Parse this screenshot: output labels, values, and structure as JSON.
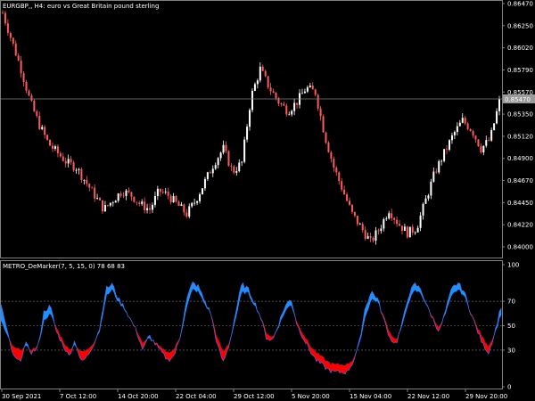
{
  "header": {
    "symbol_title": "EURGBP,, H4:  euro vs Great Britain pound sterling",
    "current_price": "0.85470"
  },
  "indicator": {
    "title": "METRO_DeMarker(7, 5, 15, 0) 78 68 83"
  },
  "colors": {
    "background": "#000000",
    "bull_candle": "#ffffff",
    "bear_candle": "#ff5a5a",
    "up_fill": "#1e90ff",
    "down_fill": "#ff0000",
    "line": "#4169e1",
    "grid": "#808080"
  },
  "price_axis": [
    "0.86470",
    "0.86250",
    "0.86020",
    "0.85790",
    "0.85570",
    "0.85350",
    "0.85120",
    "0.84900",
    "0.84670",
    "0.84450",
    "0.84220",
    "0.84000"
  ],
  "indicator_axis": [
    "100",
    "70",
    "50",
    "30",
    "0"
  ],
  "time_axis": [
    "30 Sep 2021",
    "7 Oct 12:00",
    "14 Oct 20:00",
    "22 Oct 04:00",
    "29 Oct 12:00",
    "5 Nov 20:00",
    "15 Nov 04:00",
    "22 Nov 12:00",
    "29 Nov 20:00"
  ],
  "chart_data": [
    {
      "type": "candlestick",
      "title": "EURGBP,, H4:  euro vs Great Britain pound sterling",
      "ylim": [
        0.839,
        0.865
      ],
      "current_price": 0.8547,
      "x_labels": [
        "30 Sep 2021",
        "7 Oct 12:00",
        "14 Oct 20:00",
        "22 Oct 04:00",
        "29 Oct 12:00",
        "5 Nov 20:00",
        "15 Nov 04:00",
        "22 Nov 12:00",
        "29 Nov 20:00"
      ],
      "close_path": [
        0.864,
        0.861,
        0.858,
        0.8545,
        0.852,
        0.85,
        0.849,
        0.848,
        0.8475,
        0.846,
        0.8445,
        0.843,
        0.844,
        0.845,
        0.8445,
        0.8435,
        0.843,
        0.845,
        0.8445,
        0.8435,
        0.8425,
        0.844,
        0.846,
        0.848,
        0.8495,
        0.847,
        0.848,
        0.855,
        0.858,
        0.856,
        0.8545,
        0.8535,
        0.8545,
        0.856,
        0.8555,
        0.851,
        0.8475,
        0.845,
        0.8425,
        0.841,
        0.8395,
        0.841,
        0.843,
        0.8415,
        0.8405,
        0.841,
        0.844,
        0.847,
        0.849,
        0.851,
        0.8525,
        0.8515,
        0.8495,
        0.8505,
        0.8545
      ]
    },
    {
      "type": "area",
      "title": "METRO_DeMarker(7, 5, 15, 0) 78 68 83",
      "ylim": [
        0,
        100
      ],
      "levels": [
        30,
        50,
        70
      ],
      "series": [
        {
          "values": [
            68,
            45,
            25,
            20,
            35,
            28,
            32,
            62,
            66,
            45,
            35,
            25,
            38,
            20,
            25,
            35,
            48,
            80,
            84,
            72,
            65,
            55,
            45,
            30,
            42,
            35,
            28,
            22,
            25,
            40,
            70,
            85,
            82,
            70,
            60,
            35,
            20,
            35,
            60,
            84,
            80,
            70,
            58,
            40,
            38,
            52,
            66,
            72,
            50,
            40,
            30,
            22,
            18,
            14,
            12,
            12,
            12,
            20,
            35,
            65,
            78,
            72,
            55,
            40,
            35,
            52,
            75,
            84,
            80,
            66,
            55,
            45,
            62,
            80,
            85,
            78,
            62,
            48,
            35,
            28,
            45,
            66
          ]
        },
        {
          "values": [
            55,
            42,
            32,
            30,
            33,
            30,
            33,
            55,
            60,
            48,
            38,
            30,
            35,
            28,
            30,
            36,
            46,
            74,
            80,
            70,
            64,
            55,
            46,
            35,
            40,
            36,
            31,
            28,
            30,
            40,
            64,
            80,
            78,
            68,
            60,
            40,
            28,
            36,
            56,
            78,
            77,
            68,
            58,
            44,
            40,
            50,
            62,
            68,
            52,
            43,
            34,
            28,
            24,
            20,
            18,
            18,
            18,
            22,
            34,
            58,
            72,
            70,
            57,
            44,
            38,
            50,
            70,
            79,
            77,
            66,
            56,
            48,
            60,
            75,
            80,
            75,
            62,
            50,
            40,
            33,
            44,
            60
          ]
        }
      ]
    }
  ]
}
